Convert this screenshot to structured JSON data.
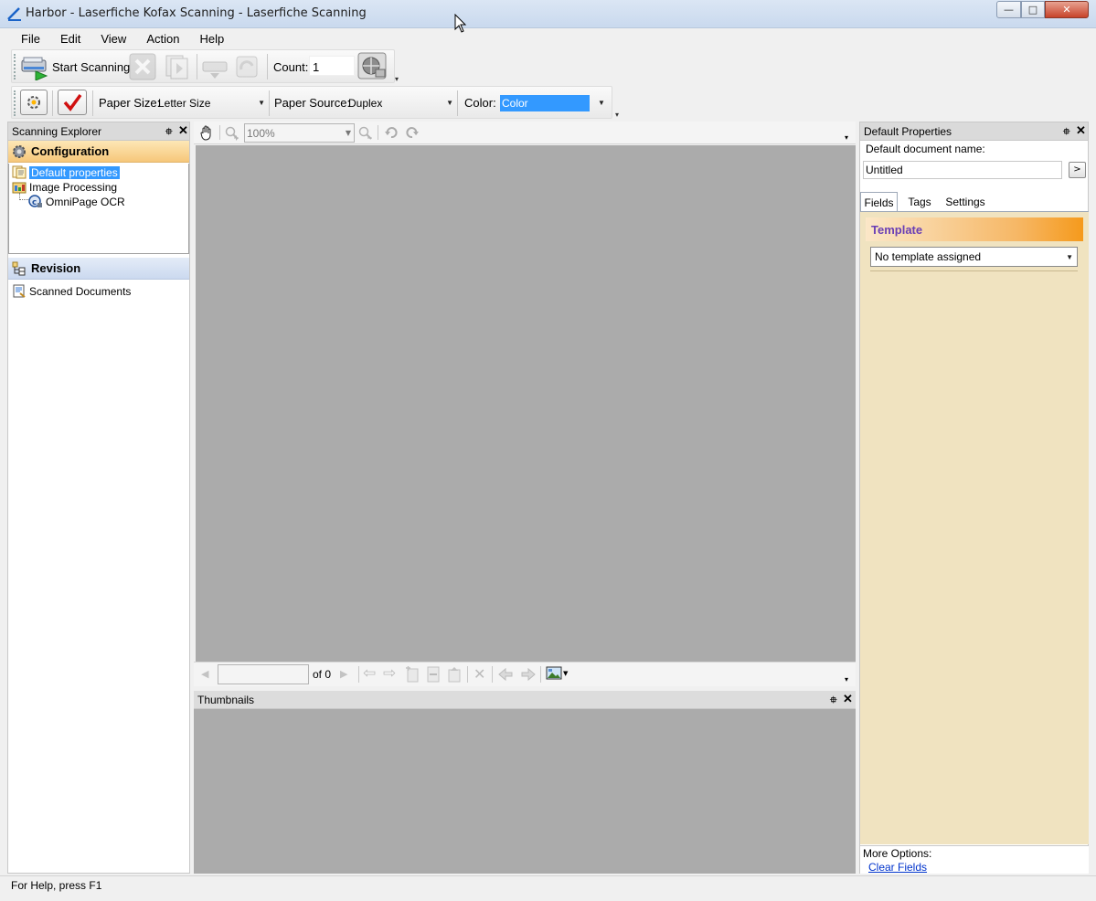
{
  "window": {
    "title": "Harbor - Laserfiche Kofax Scanning - Laserfiche Scanning",
    "minimize_icon": "minimize-icon",
    "maximize_icon": "maximize-icon",
    "close_icon": "close-icon"
  },
  "menu": [
    "File",
    "Edit",
    "View",
    "Action",
    "Help"
  ],
  "toolbar1": {
    "start_scanning": "Start Scanning",
    "count_label": "Count:",
    "count_value": "1"
  },
  "toolbar2": {
    "paper_size_label": "Paper Size:",
    "paper_size_value": "Letter Size",
    "paper_source_label": "Paper Source:",
    "paper_source_value": "Duplex",
    "color_label": "Color:",
    "color_value": "Color"
  },
  "left_panel": {
    "title": "Scanning Explorer",
    "configuration": "Configuration",
    "tree": {
      "default_properties": "Default properties",
      "image_processing": "Image Processing",
      "omnipage_ocr": "OmniPage OCR"
    },
    "revision": "Revision",
    "scanned_documents": "Scanned Documents"
  },
  "viewer": {
    "zoom": "100%",
    "page_of": "of 0",
    "page_input": ""
  },
  "thumbnails": {
    "title": "Thumbnails"
  },
  "right_panel": {
    "title": "Default Properties",
    "doc_name_label": "Default document name:",
    "doc_name_value": "Untitled",
    "browse_button": ">",
    "tabs": {
      "fields": "Fields",
      "tags": "Tags",
      "settings": "Settings"
    },
    "template_header": "Template",
    "template_value": "No template assigned",
    "more_options": "More Options:",
    "clear_fields": "Clear Fields"
  },
  "statusbar": {
    "text": "For Help, press F1"
  },
  "colors": {
    "selection": "#3399ff",
    "viewer_bg": "#ababab",
    "fields_bg": "#f0e3c0",
    "template_text": "#6a3fb5",
    "color_highlight": "#3399ff",
    "link": "#0033cc"
  }
}
